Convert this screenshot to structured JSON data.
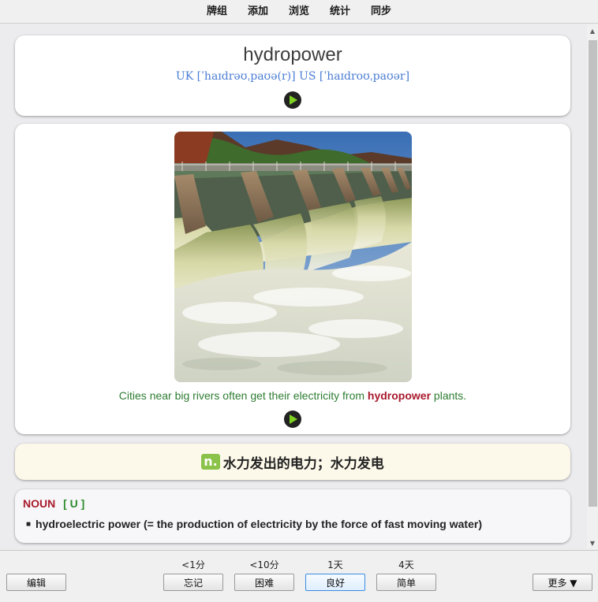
{
  "menu": {
    "items": [
      "牌组",
      "添加",
      "浏览",
      "统计",
      "同步"
    ]
  },
  "card_front": {
    "word": "hydropower",
    "phonetic": "UK [ˈhaɪdrəʊˌpaʊə(r)] US [ˈhaɪdroʊˌpaʊər]"
  },
  "example": {
    "before": "Cities near big rivers often get their electricity from ",
    "highlight": "hydropower",
    "after": " plants."
  },
  "meaning": {
    "pos": "n.",
    "text": "水力发出的电力；水力发电"
  },
  "definition": {
    "pos": "NOUN",
    "countability": "[ U ]",
    "text": "hydroelectric power (= the production of electricity by the force of fast moving water)"
  },
  "bottom": {
    "edit_label": "编辑",
    "more_label": "更多 ▼",
    "answers": [
      {
        "interval": "<1分",
        "label": "忘记"
      },
      {
        "interval": "<10分",
        "label": "困难"
      },
      {
        "interval": "1天",
        "label": "良好"
      },
      {
        "interval": "4天",
        "label": "简单"
      }
    ]
  },
  "colors": {
    "word": "#3d3d3d",
    "phonetic": "#4a7dd4",
    "example": "#2e7d32",
    "highlight": "#a8192c",
    "pos_badge": "#8bc34a",
    "selected_button_border": "#3c8be0"
  },
  "icons": {
    "play": "play-circle-icon"
  }
}
